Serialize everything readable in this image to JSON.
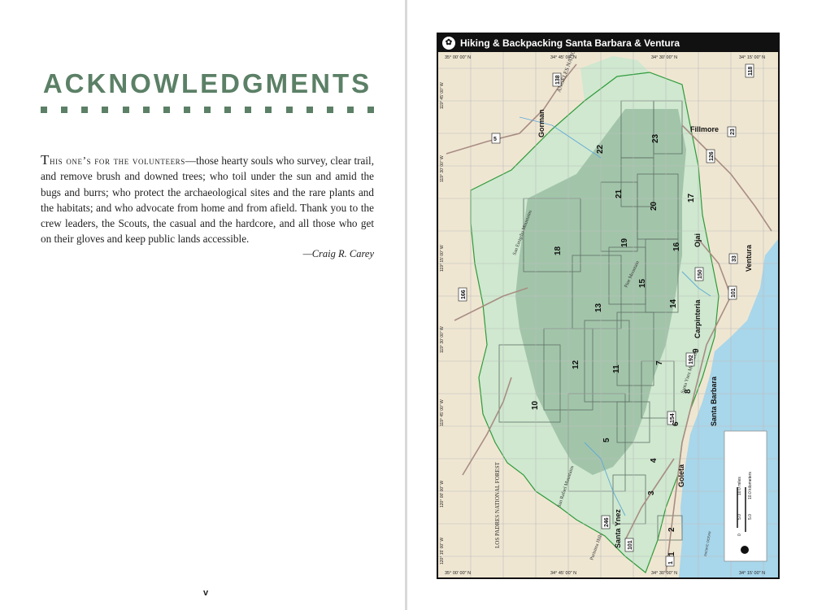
{
  "left_page": {
    "heading": "ACKNOWLEDGMENTS",
    "lead_big": "T",
    "lead_small": "his one’s for the volunteers",
    "body": "—those hearty souls who survey, clear trail, and remove brush and downed trees; who toil under the sun and amid the bugs and burrs; who protect the archaeological sites and the rare plants and the habitats; and who advocate from home and from afield. Thank you to the crew leaders, the Scouts, the casual and the hardcore, and all those who get on their gloves and keep public lands accessible.",
    "signature": "—Craig R. Carey",
    "folio": "v"
  },
  "map": {
    "title": "Hiking & Backpacking Santa Barbara & Ventura",
    "logo_icon": "hiker-logo-icon",
    "colors": {
      "land": "#efe6d2",
      "forest": "#cfe8cf",
      "water": "#a8d6ea",
      "road": "#a88d83",
      "boundary": "#2e9b3a",
      "grid": "#bdbdbd",
      "region": "#8fb79a"
    },
    "lat_labels": [
      "35° 00' 00\" N",
      "34° 45' 00\" N",
      "34° 30' 00\" N",
      "34° 15' 00\" N"
    ],
    "lon_labels": [
      "119° 45' 00\" W",
      "119° 30' 00\" W",
      "119° 15' 00\" W",
      "119° 30' 00\" W",
      "119° 45' 00\" W",
      "120° 00' 00\" W",
      "120° 15' 00\" W"
    ],
    "places": {
      "angeles": "ANGELES NATIONAL FOREST",
      "los_padres": "LOS PADRES NATIONAL FOREST",
      "gorman": "Gorman",
      "fillmore": "Fillmore",
      "ojai": "Ojai",
      "ventura": "Ventura",
      "carpinteria": "Carpinteria",
      "santa_barbara": "Santa Barbara",
      "goleta": "Goleta",
      "santa_ynez": "Santa Ynez",
      "pacific": "PACIFIC OCEAN"
    },
    "ranges": {
      "san_emigdio": "San Emigdio Mountains",
      "pine": "Pine Mountain",
      "santa_ynez": "Santa Ynez Mountains",
      "san_rafael": "San Rafael Mountains",
      "purisima": "Purisima Hills",
      "santa_ynez2": "Santa Ynez Mountains"
    },
    "highways": [
      "5",
      "138",
      "126",
      "23",
      "118",
      "33",
      "150",
      "101",
      "192",
      "154",
      "166",
      "246",
      "1"
    ],
    "hike_numbers": [
      "1",
      "2",
      "3",
      "4",
      "5",
      "6",
      "7",
      "8",
      "9",
      "10",
      "11",
      "12",
      "13",
      "14",
      "15",
      "16",
      "17",
      "18",
      "19",
      "20",
      "21",
      "22",
      "23"
    ],
    "scale": {
      "miles": "10.0 miles",
      "km": "10.0 kilometers",
      "zero": "0",
      "five_mi": "5.0",
      "five_km": "5.0"
    }
  }
}
